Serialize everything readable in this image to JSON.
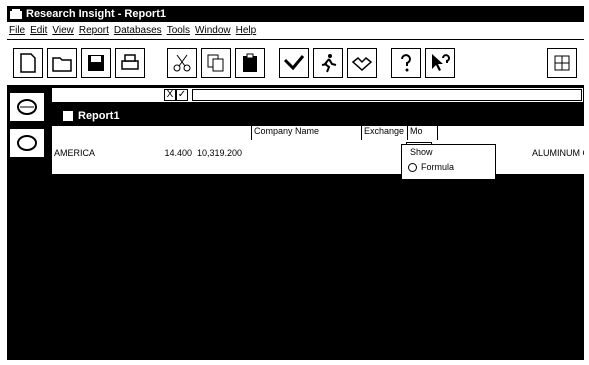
{
  "app": {
    "title": "Research Insight - Report1"
  },
  "menu": [
    {
      "label": "File"
    },
    {
      "label": "Edit"
    },
    {
      "label": "View"
    },
    {
      "label": "Report"
    },
    {
      "label": "Databases"
    },
    {
      "label": "Tools"
    },
    {
      "label": "Window"
    },
    {
      "label": "Help"
    }
  ],
  "formula_bar": {
    "cancel": "X",
    "ok": "✓",
    "value": ""
  },
  "report": {
    "title": "Report1",
    "columns": [
      "Company Name",
      "Exchange",
      "Mo"
    ],
    "rows": [
      {
        "name": "AMERICA",
        "v1": "14.400",
        "v2": "10,319.200",
        "right": "ALUMINUM CO"
      }
    ]
  },
  "show_panel": {
    "legend": "Show",
    "option": "Formula"
  }
}
